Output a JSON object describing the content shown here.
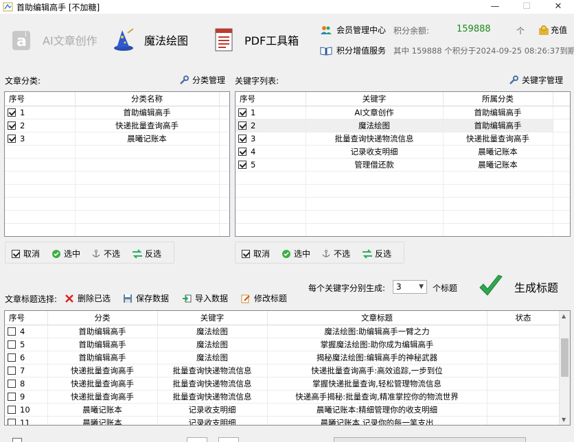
{
  "window": {
    "title": "首助编辑高手 [不加糖]",
    "min": "—",
    "max": "☐",
    "close": "✕"
  },
  "toolbar": {
    "ai_label": "AI文章创作",
    "magic_label": "魔法绘图",
    "pdf_label": "PDF工具箱"
  },
  "account": {
    "member_label": "会员管理中心",
    "points_label": "积分余额:",
    "points_value": "159888",
    "points_unit": "个",
    "recharge_label": "充值",
    "addon_label": "积分增值服务",
    "expiry_text": "其中 159888 个积分于2024-09-25 08:26:37到期"
  },
  "category_panel": {
    "label": "文章分类:",
    "manage_label": "分类管理",
    "headers": [
      "序号",
      "分类名称"
    ],
    "rows": [
      {
        "checked": true,
        "no": "1",
        "name": "首助编辑高手"
      },
      {
        "checked": true,
        "no": "2",
        "name": "快递批量查询高手"
      },
      {
        "checked": true,
        "no": "3",
        "name": "晨曦记账本"
      }
    ],
    "actions": {
      "cancel": "取消",
      "select": "选中",
      "unselect": "不选",
      "invert": "反选"
    }
  },
  "keyword_panel": {
    "label": "关键字列表:",
    "manage_label": "关键字管理",
    "headers": [
      "序号",
      "关键字",
      "所属分类"
    ],
    "rows": [
      {
        "checked": true,
        "no": "1",
        "keyword": "AI文章创作",
        "category": "首助编辑高手"
      },
      {
        "checked": true,
        "no": "2",
        "keyword": "魔法绘图",
        "category": "首助编辑高手"
      },
      {
        "checked": true,
        "no": "3",
        "keyword": "批量查询快递物流信息",
        "category": "快递批量查询高手"
      },
      {
        "checked": true,
        "no": "4",
        "keyword": "记录收支明细",
        "category": "晨曦记账本"
      },
      {
        "checked": true,
        "no": "5",
        "keyword": "管理借还款",
        "category": "晨曦记账本"
      }
    ],
    "actions": {
      "cancel": "取消",
      "select": "选中",
      "unselect": "不选",
      "invert": "反选"
    }
  },
  "generate": {
    "per_keyword_label": "每个关键字分别生成:",
    "count_value": "3",
    "unit_label": "个标题",
    "generate_label": "生成标题"
  },
  "title_panel": {
    "label": "文章标题选择:",
    "delete_label": "删除已选",
    "save_label": "保存数据",
    "import_label": "导入数据",
    "edit_label": "修改标题",
    "headers": [
      "序号",
      "分类",
      "关键字",
      "文章标题",
      "状态"
    ],
    "rows": [
      {
        "no": "4",
        "category": "首助编辑高手",
        "keyword": "魔法绘图",
        "title": "魔法绘图:助编辑高手一臂之力",
        "status": ""
      },
      {
        "no": "5",
        "category": "首助编辑高手",
        "keyword": "魔法绘图",
        "title": "掌握魔法绘图:助你成为编辑高手",
        "status": ""
      },
      {
        "no": "6",
        "category": "首助编辑高手",
        "keyword": "魔法绘图",
        "title": "揭秘魔法绘图:编辑高手的神秘武器",
        "status": ""
      },
      {
        "no": "7",
        "category": "快递批量查询高手",
        "keyword": "批量查询快递物流信息",
        "title": "快递批量查询高手:高效追踪,一步到位",
        "status": ""
      },
      {
        "no": "8",
        "category": "快递批量查询高手",
        "keyword": "批量查询快递物流信息",
        "title": "掌握快递批量查询,轻松管理物流信息",
        "status": ""
      },
      {
        "no": "9",
        "category": "快递批量查询高手",
        "keyword": "批量查询快递物流信息",
        "title": "快递高手揭秘:批量查询,精准掌控你的物流世界",
        "status": ""
      },
      {
        "no": "10",
        "category": "晨曦记账本",
        "keyword": "记录收支明细",
        "title": "晨曦记账本:精细管理你的收支明细",
        "status": ""
      },
      {
        "no": "11",
        "category": "晨曦记账本",
        "keyword": "记录收支明细",
        "title": "晨曦记账本,记录你的每一笔支出",
        "status": ""
      }
    ]
  }
}
